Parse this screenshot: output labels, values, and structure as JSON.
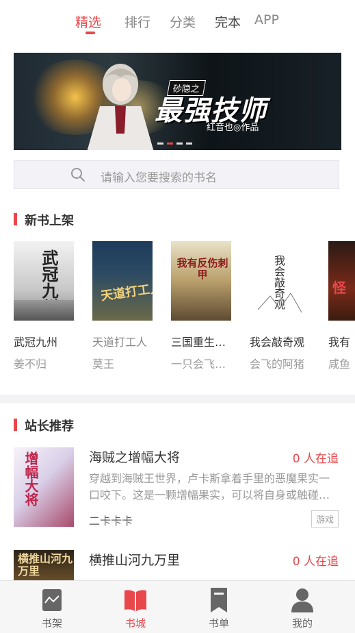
{
  "nav": {
    "tabs": [
      "精选",
      "排行",
      "分类",
      "完本",
      "APP"
    ],
    "active_index": 0
  },
  "banner": {
    "tag": "砂隐之",
    "title": "最强技师",
    "author": "红音也◎作品",
    "slides": 4,
    "active_slide": 1
  },
  "search": {
    "placeholder": "请输入您要搜索的书名"
  },
  "new_books": {
    "heading": "新书上架",
    "items": [
      {
        "name": "武冠九州",
        "author": "姜不归"
      },
      {
        "name": "天道打工人",
        "author": "莫王"
      },
      {
        "name": "三国重生…",
        "author": "一只会飞…"
      },
      {
        "name": "我会敲奇观",
        "author": "会飞的阿猪"
      },
      {
        "name": "我有",
        "author": "咸鱼"
      }
    ],
    "cover_texts": [
      "武冠九州",
      "天道打工人",
      "我有反伤刺甲",
      "我会敲奇观",
      "怪"
    ]
  },
  "recommend": {
    "heading": "站长推荐",
    "items": [
      {
        "title": "海贼之增幅大将",
        "follow": "0 人在追",
        "desc": "穿越到海贼王世界，卢卡斯拿着手里的恶魔果实一口咬下。这是一颗增幅果实，可以将自身或触碰…",
        "author": "二卡卡卡",
        "tag": "游戏",
        "cover_text": "增幅大将"
      },
      {
        "title": "横推山河九万里",
        "follow": "0 人在追",
        "cover_text": "横推山河九万里"
      }
    ]
  },
  "bottom_nav": {
    "items": [
      "书架",
      "书城",
      "书单",
      "我的"
    ],
    "active_index": 1
  },
  "colors": {
    "accent": "#e8474b"
  }
}
